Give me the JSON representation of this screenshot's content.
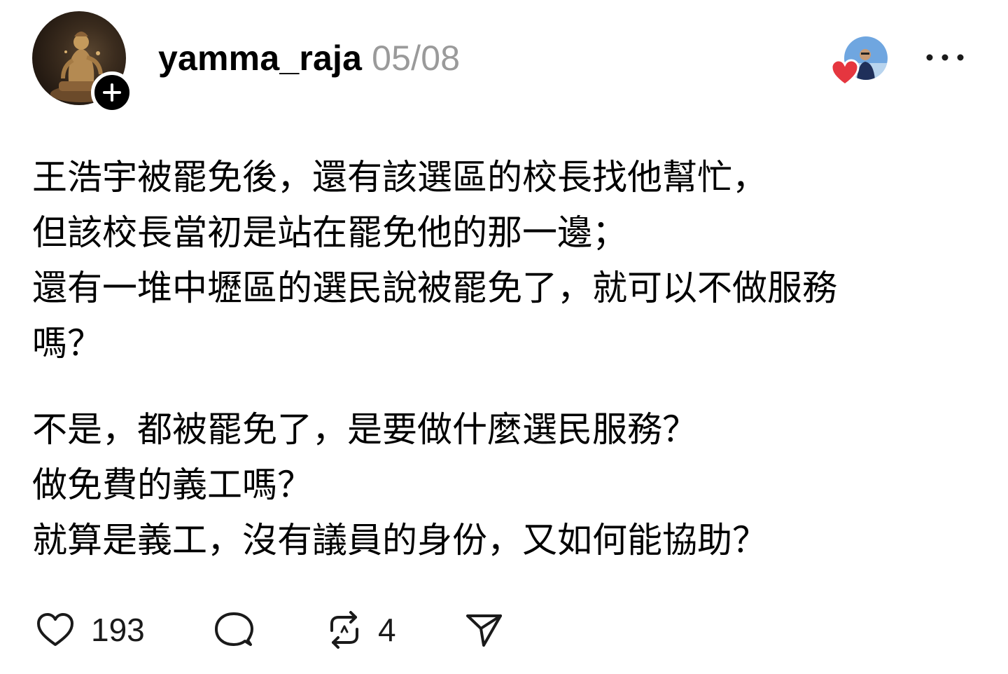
{
  "header": {
    "username": "yamma_raja",
    "date": "05/08",
    "follow_symbol": "+"
  },
  "post": {
    "paragraphs": [
      [
        "王浩宇被罷免後，還有該選區的校長找他幫忙，",
        "但該校長當初是站在罷免他的那一邊；",
        "還有一堆中壢區的選民說被罷免了，就可以不做服務",
        "嗎？"
      ],
      [
        "不是，都被罷免了，是要做什麼選民服務？",
        "做免費的義工嗎？",
        "就算是義工，沒有議員的身份，又如何能協助？"
      ]
    ]
  },
  "actions": {
    "likes": "193",
    "reposts": "4"
  },
  "icons": {
    "like": "heart-outline-icon",
    "comment": "speech-bubble-icon",
    "repost": "repost-arrows-icon",
    "share": "paper-plane-icon",
    "more": "ellipsis-icon",
    "liked": "red-heart-icon"
  },
  "colors": {
    "text": "#000000",
    "date": "#9a9a9a",
    "icon": "#1a1a1a",
    "liked_heart": "#e5363f"
  }
}
